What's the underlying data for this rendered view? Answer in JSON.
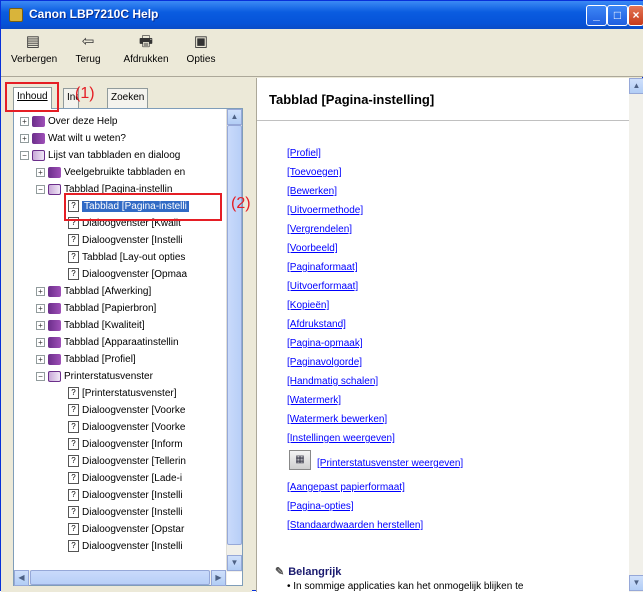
{
  "window": {
    "title": "Canon LBP7210C Help",
    "controls": [
      "_",
      "□",
      "×"
    ]
  },
  "toolbar": {
    "items": [
      {
        "label": "Verbergen",
        "icon": "hide-pane-icon"
      },
      {
        "label": "Terug",
        "icon": "back-arrow-icon"
      },
      {
        "label": "Afdrukken",
        "icon": "printer-icon"
      },
      {
        "label": "Opties",
        "icon": "options-icon"
      }
    ]
  },
  "nav_tabs": {
    "contents": "Inhoud",
    "index": "Index",
    "search": "Zoeken"
  },
  "annotations": {
    "one": "(1)",
    "two": "(2)"
  },
  "tree": [
    {
      "text": "Over deze Help"
    },
    {
      "text": "Wat wilt u weten?"
    },
    {
      "text": "Lijst van tabbladen en dialoog"
    },
    {
      "text": "Veelgebruikte tabbladen en"
    },
    {
      "text": "Tabblad [Pagina-instellin"
    },
    {
      "text": "Tabblad [Pagina-instelli"
    },
    {
      "text": "Dialoogvenster [Kwalit"
    },
    {
      "text": "Dialoogvenster [Instelli"
    },
    {
      "text": "Tabblad [Lay-out opties"
    },
    {
      "text": "Dialoogvenster [Opmaa"
    },
    {
      "text": "Tabblad [Afwerking]"
    },
    {
      "text": "Tabblad [Papierbron]"
    },
    {
      "text": "Tabblad [Kwaliteit]"
    },
    {
      "text": "Tabblad [Apparaatinstellin"
    },
    {
      "text": "Tabblad [Profiel]"
    },
    {
      "text": "Printerstatusvenster"
    },
    {
      "text": "[Printerstatusvenster]"
    },
    {
      "text": "Dialoogvenster [Voorke"
    },
    {
      "text": "Dialoogvenster [Voorke"
    },
    {
      "text": "Dialoogvenster [Inform"
    },
    {
      "text": "Dialoogvenster [Tellerin"
    },
    {
      "text": "Dialoogvenster [Lade-i"
    },
    {
      "text": "Dialoogvenster [Instelli"
    },
    {
      "text": "Dialoogvenster [Instelli"
    },
    {
      "text": "Dialoogvenster [Opstar"
    },
    {
      "text": "Dialoogvenster [Instelli"
    }
  ],
  "content": {
    "title": "Tabblad [Pagina-instelling]",
    "links": [
      "[Profiel]",
      "[Toevoegen]",
      "[Bewerken]",
      "[Uitvoermethode]",
      "[Vergrendelen]",
      "[Voorbeeld]",
      "[Paginaformaat]",
      "[Uitvoerformaat]",
      "[Kopieën]",
      "[Afdrukstand]",
      "[Pagina-opmaak]",
      "[Paginavolgorde]",
      "[Handmatig schalen]",
      "[Watermerk]",
      "[Watermerk bewerken]",
      "[Instellingen weergeven]",
      "[Printerstatusvenster weergeven]",
      "[Aangepast papierformaat]",
      "[Pagina-opties]",
      "[Standaardwaarden herstellen]"
    ],
    "important_heading": "Belangrijk",
    "important_text": "In sommige applicaties kan het onmogelijk blijken te"
  }
}
